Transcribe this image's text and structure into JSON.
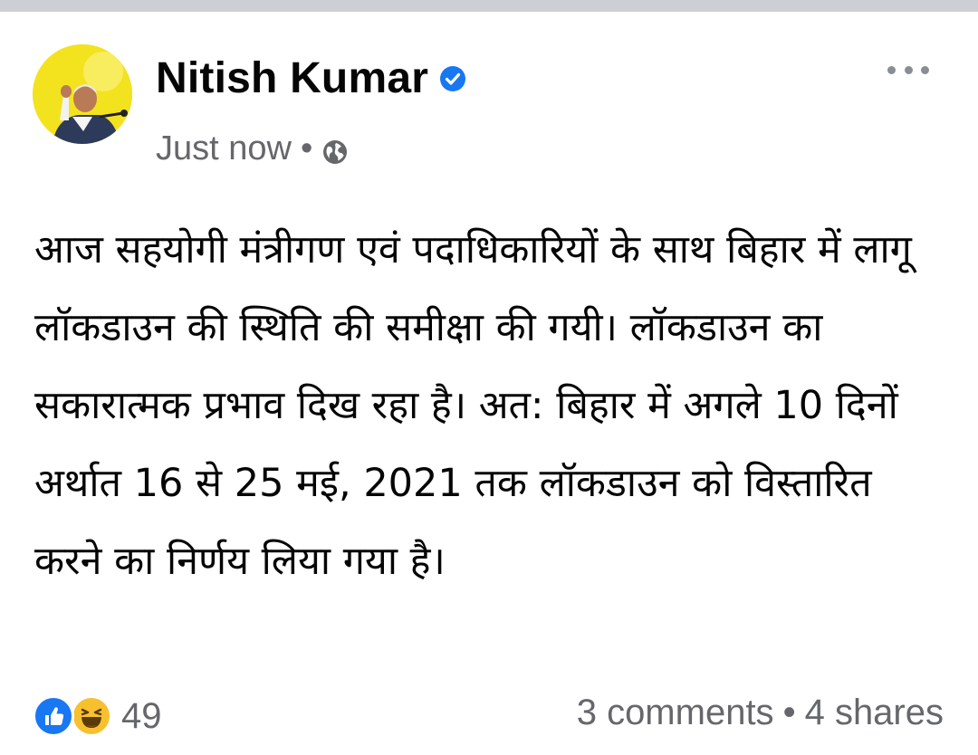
{
  "post": {
    "author": "Nitish Kumar",
    "verified": true,
    "timestamp": "Just now",
    "separator": "•",
    "audience_icon": "globe-icon",
    "more_icon": "more-horizontal-icon",
    "text": "आज सहयोगी मंत्रीगण एवं पदाधिकारियों के साथ बिहार में लागू लॉकडाउन की स्थिति की समीक्षा की गयी। लॉकडाउन का सकारात्मक प्रभाव दिख रहा है। अत: बिहार में अगले 10 दिनों अर्थात 16 से 25 मई, 2021 तक लॉकडाउन को विस्तारित करने का निर्णय लिया गया है।"
  },
  "footer": {
    "reaction_icons": [
      "like-icon",
      "haha-icon"
    ],
    "reaction_count": "49",
    "comments": "3 comments",
    "separator": "•",
    "shares": "4 shares"
  },
  "colors": {
    "top_strip": "#ccd0d5",
    "verified": "#1877f2",
    "secondary_text": "#65676b",
    "like": "#1877f2",
    "haha": "#f7c02f",
    "avatar_bg": "#f4e41c"
  }
}
